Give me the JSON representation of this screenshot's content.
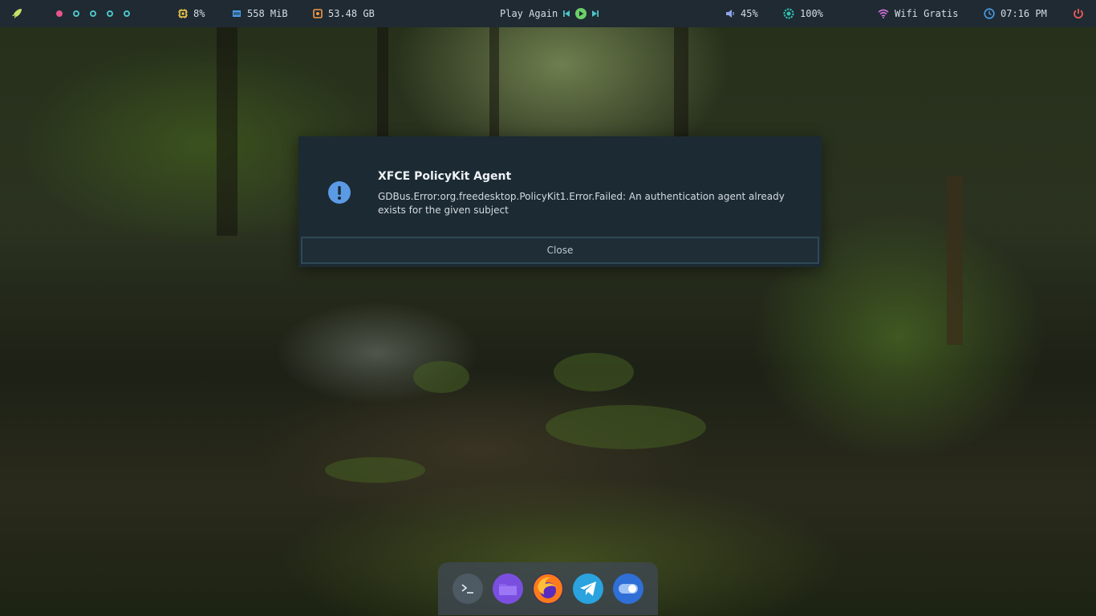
{
  "topbar": {
    "launcher_icon": "rocket-icon",
    "workspaces": [
      {
        "active": true
      },
      {
        "active": false
      },
      {
        "active": false
      },
      {
        "active": false
      },
      {
        "active": false
      }
    ],
    "cpu": {
      "icon": "cpu-icon",
      "value": "8%"
    },
    "memory": {
      "icon": "memory-icon",
      "value": "558 MiB"
    },
    "disk": {
      "icon": "disk-icon",
      "value": "53.48 GB"
    },
    "media": {
      "title": "Play Again",
      "prev_icon": "skip-previous-icon",
      "play_icon": "play-icon",
      "next_icon": "skip-next-icon"
    },
    "volume": {
      "icon": "volume-icon",
      "value": "45%"
    },
    "brightness": {
      "icon": "brightness-icon",
      "value": "100%"
    },
    "wifi": {
      "icon": "wifi-icon",
      "value": "Wifi Gratis"
    },
    "clock": {
      "icon": "clock-icon",
      "value": "07:16 PM"
    },
    "power_icon": "power-icon"
  },
  "dialog": {
    "icon": "alert-icon",
    "title": "XFCE PolicyKit Agent",
    "message": "GDBus.Error:org.freedesktop.PolicyKit1.Error.Failed: An authentication agent already exists for the given subject",
    "close_label": "Close"
  },
  "dock": {
    "apps": [
      {
        "icon": "terminal-icon"
      },
      {
        "icon": "folder-icon"
      },
      {
        "icon": "firefox-icon"
      },
      {
        "icon": "telegram-icon"
      },
      {
        "icon": "settings-toggle-icon"
      }
    ]
  },
  "colors": {
    "bar_bg": "#1f2a33",
    "accent_teal": "#4fc3c7",
    "accent_pink": "#e8548a",
    "dialog_bg": "#1c2a33",
    "info_blue": "#5b9be5"
  }
}
